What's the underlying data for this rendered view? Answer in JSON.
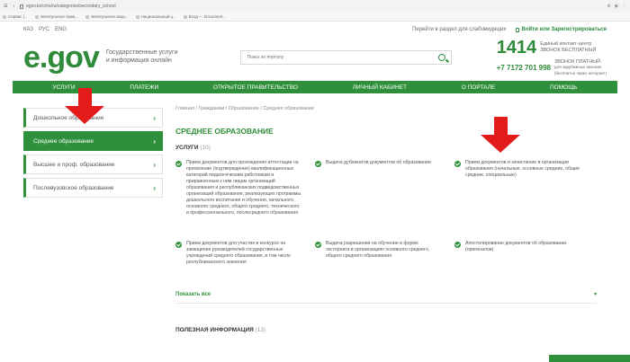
{
  "browser": {
    "url": "egov.kz/cms/ru/categories/secondary_school",
    "bookmarks": [
      "Сервис |...",
      "Электронное прав...",
      "Электронное акци...",
      "Национальный ц...",
      "Вход — Document..."
    ]
  },
  "topbar": {
    "langs": [
      "КАЗ",
      "РУС",
      "ENG"
    ],
    "link": "Перейти в раздел для слабовидящих",
    "login": "Войти или Зарегистрироваться"
  },
  "header": {
    "logo_text": "e.gov",
    "logo_desc_1": "Государственные услуги",
    "logo_desc_2": "и информация онлайн",
    "search_placeholder": "Поиск по порталу",
    "contact_num": "1414",
    "contact_desc1": "Единый контакт-центр",
    "contact_desc1b": "ЗВОНОК БЕСПЛАТНЫЙ",
    "contact_phone": "+7 7172 701 998",
    "contact_desc2": "ЗВОНОК ПЛАТНЫЙ",
    "contact_desc2b": "для зарубежных звонков",
    "contact_desc2c": "(бесплатно через интернет)"
  },
  "nav": [
    "УСЛУГИ",
    "ПЛАТЕЖИ",
    "ОТКРЫТОЕ ПРАВИТЕЛЬСТВО",
    "ЛИЧНЫЙ КАБИНЕТ",
    "О ПОРТАЛЕ",
    "ПОМОЩЬ"
  ],
  "sidebar": [
    {
      "label": "Дошкольное образование"
    },
    {
      "label": "Среднее образование"
    },
    {
      "label": "Высшее и проф. образование"
    },
    {
      "label": "Послевузовское образование"
    }
  ],
  "main": {
    "breadcrumb": "Главная / Гражданам / Образование / Среднее образование",
    "title": "СРЕДНЕЕ ОБРАЗОВАНИЕ",
    "services_title": "УСЛУГИ",
    "services_count": "(10)",
    "services": [
      "Прием документов для прохождения аттестации на присвоение (подтверждение) квалификационных категорий педагогическим работникам и приравненным к ним лицам организаций образования и республиканских подведомственных организаций образования, реализующих программы дошкольного воспитания и обучения, начального, основного среднего, общего среднего, технического и профессионального, послесреднего образования",
      "Выдача дубликатов документов об образовании",
      "Прием документов и зачисление в организации образования (начальные, основные средние, общие средние, специальные)",
      "Прием документов для участия в конкурсе на замещение руководителей государственных учреждений среднего образования, в том числе республиканского значения",
      "Выдача разрешения на обучение в форме экстерната в организациях основного среднего, общего среднего образования",
      "Апостилирование документов об образовании (оригиналов)"
    ],
    "show_all": "Показать все",
    "useful_title": "ПОЛЕЗНАЯ ИНФОРМАЦИЯ",
    "useful_count": "(13)"
  }
}
